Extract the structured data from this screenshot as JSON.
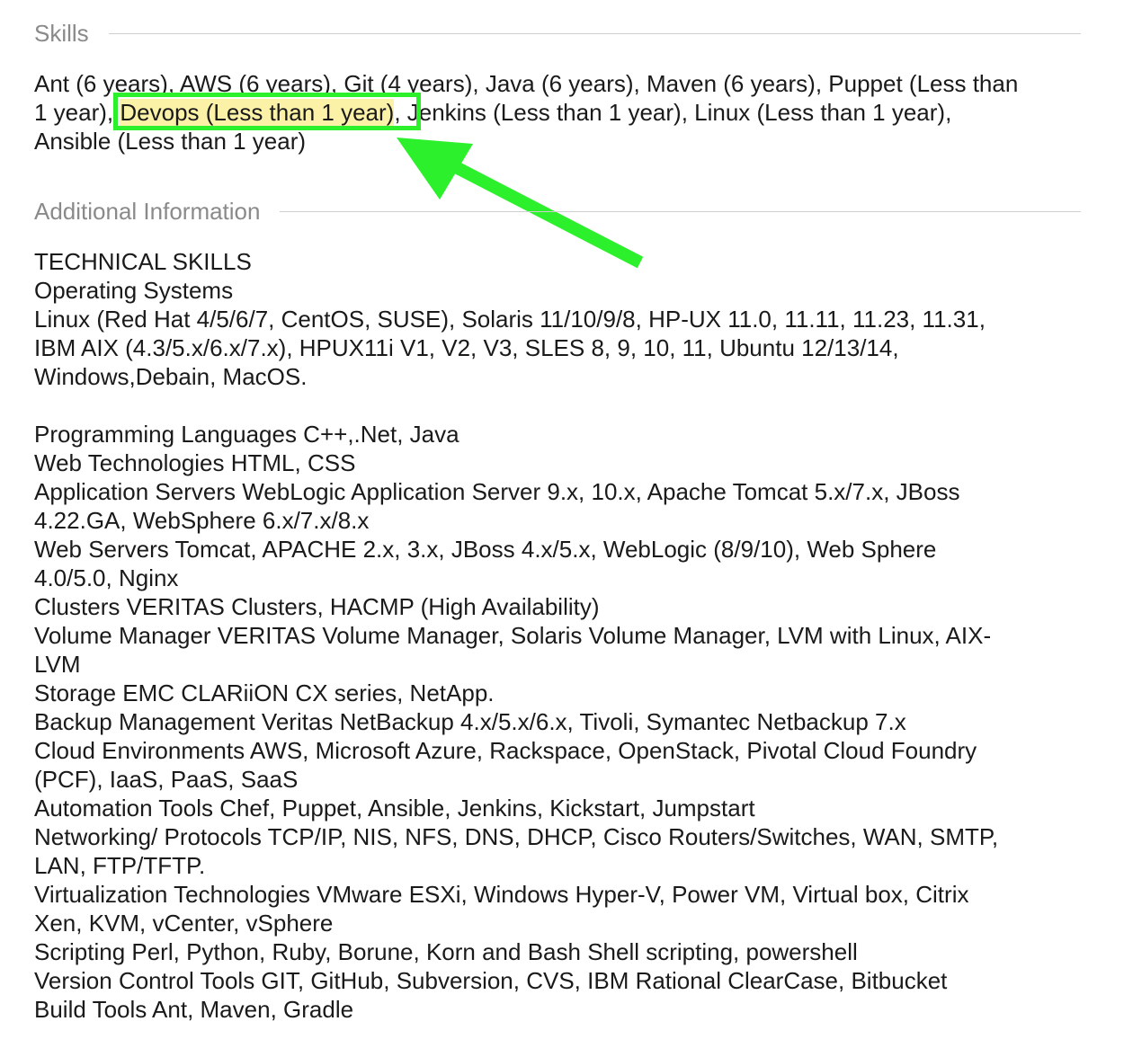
{
  "skills": {
    "heading": "Skills",
    "line1": "Ant (6 years), AWS (6 years), Git (4 years), Java (6 years), Maven (6 years), Puppet (Less than",
    "line2_pre": "1 year), ",
    "line2_highlight": "Devops (Less than 1 year)",
    "line2_post": ", Jenkins (Less than 1 year), Linux (Less than 1 year),",
    "line3": "Ansible (Less than 1 year)"
  },
  "additional": {
    "heading": "Additional Information",
    "lines": [
      "TECHNICAL SKILLS",
      "Operating Systems",
      "Linux (Red Hat 4/5/6/7, CentOS, SUSE), Solaris 11/10/9/8, HP-UX 11.0, 11.11, 11.23, 11.31,",
      "IBM AIX (4.3/5.x/6.x/7.x), HPUX11i V1, V2, V3, SLES 8, 9, 10, 11, Ubuntu 12/13/14,",
      "Windows,Debain, MacOS.",
      "",
      "Programming Languages C++,.Net, Java",
      "Web Technologies HTML, CSS",
      "Application Servers WebLogic Application Server 9.x, 10.x, Apache Tomcat 5.x/7.x, JBoss",
      "4.22.GA, WebSphere 6.x/7.x/8.x",
      "Web Servers Tomcat, APACHE 2.x, 3.x, JBoss 4.x/5.x, WebLogic (8/9/10), Web Sphere",
      "4.0/5.0, Nginx",
      "Clusters VERITAS Clusters, HACMP (High Availability)",
      "Volume Manager VERITAS Volume Manager, Solaris Volume Manager, LVM with Linux, AIX-",
      "LVM",
      "Storage EMC CLARiiON CX series, NetApp.",
      "Backup Management Veritas NetBackup 4.x/5.x/6.x, Tivoli, Symantec Netbackup 7.x",
      "Cloud Environments AWS, Microsoft Azure, Rackspace, OpenStack, Pivotal Cloud Foundry",
      "(PCF), IaaS, PaaS, SaaS",
      "Automation Tools Chef, Puppet, Ansible, Jenkins, Kickstart, Jumpstart",
      "Networking/ Protocols TCP/IP, NIS, NFS, DNS, DHCP, Cisco Routers/Switches, WAN, SMTP,",
      "LAN, FTP/TFTP.",
      "Virtualization Technologies VMware ESXi, Windows Hyper-V, Power VM, Virtual box, Citrix",
      "Xen, KVM, vCenter, vSphere",
      "Scripting Perl, Python, Ruby, Borune, Korn and Bash Shell scripting, powershell",
      "Version Control Tools GIT, GitHub, Subversion, CVS, IBM Rational ClearCase, Bitbucket",
      "Build Tools Ant, Maven, Gradle"
    ]
  },
  "colors": {
    "annotation": "#2cf02c",
    "highlight": "#fbf2a8",
    "heading": "#8a8a8a"
  },
  "annotation": {
    "box_icon": "highlight-box",
    "arrow_icon": "arrow-up-left-icon"
  }
}
